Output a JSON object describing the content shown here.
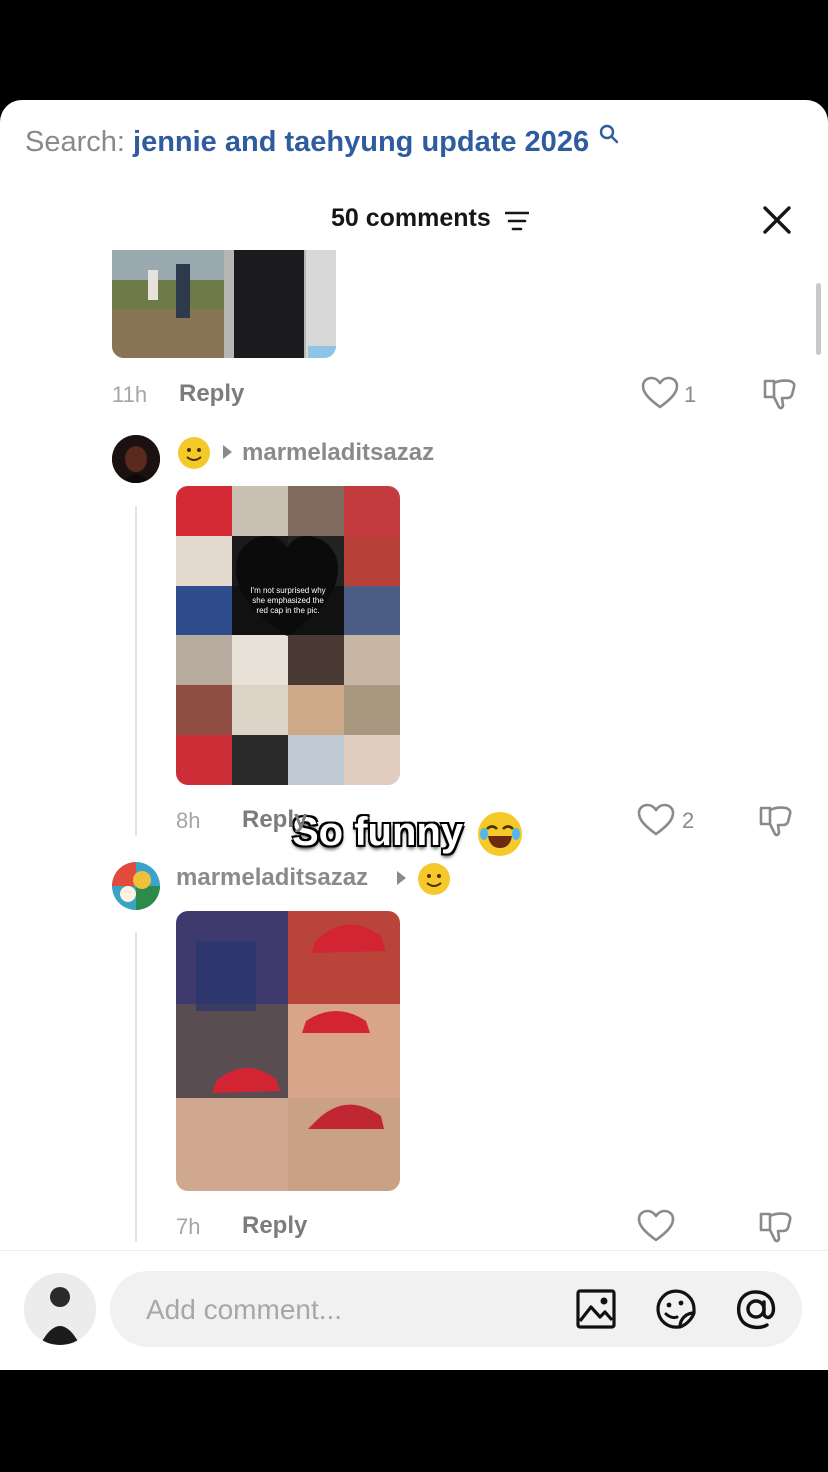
{
  "search": {
    "label": "Search:",
    "query": "jennie and taehyung update 2026"
  },
  "header": {
    "count_title": "50 comments"
  },
  "comments": [
    {
      "time": "11h",
      "reply": "Reply",
      "likes": "1"
    },
    {
      "username": "marmeladitsazaz",
      "image_caption": "I'm not surprised why she emphasized the red cap in the pic.",
      "overlay_text": "So funny",
      "time": "8h",
      "reply": "Reply",
      "likes": "2"
    },
    {
      "username": "marmeladitsazaz",
      "time": "7h",
      "reply": "Reply",
      "likes": ""
    }
  ],
  "composer": {
    "placeholder": "Add comment..."
  },
  "icons": {
    "close": "close-icon",
    "sort": "sort-icon",
    "image": "image-icon",
    "sticker": "sticker-icon",
    "mention": "at-mention-icon",
    "like": "heart-icon",
    "dislike": "thumbs-down-icon"
  },
  "colors": {
    "query": "#2f5c9e",
    "muted": "#8a8a8a",
    "accent_red": "#d32433"
  }
}
